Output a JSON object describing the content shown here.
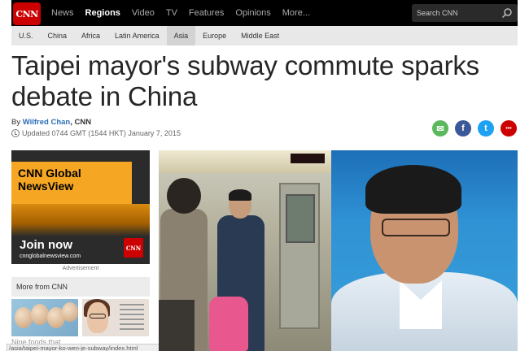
{
  "nav": {
    "logo": "CNN",
    "items": [
      "News",
      "Regions",
      "Video",
      "TV",
      "Features",
      "Opinions",
      "More..."
    ],
    "active": "Regions",
    "search_placeholder": "Search CNN"
  },
  "subnav": {
    "items": [
      "U.S.",
      "China",
      "Africa",
      "Latin America",
      "Asia",
      "Europe",
      "Middle East"
    ],
    "active": "Asia"
  },
  "article": {
    "headline": "Taipei mayor's subway commute sparks debate in China",
    "by_prefix": "By",
    "author": "Wilfred Chan",
    "source": ", CNN",
    "updated": "Updated 0744 GMT (1544 HKT) January 7, 2015"
  },
  "share": [
    {
      "name": "email-share-icon",
      "glyph": "✉",
      "color": "#5cb85c"
    },
    {
      "name": "facebook-share-icon",
      "glyph": "f",
      "color": "#3b5998"
    },
    {
      "name": "twitter-share-icon",
      "glyph": "t",
      "color": "#1da1f2"
    },
    {
      "name": "more-share-icon",
      "glyph": "•••",
      "color": "#cc0000"
    }
  ],
  "ad": {
    "title": "CNN Global NewsView",
    "cta": "Join now",
    "url": "cnnglobalnewsview.com",
    "logo": "CNN",
    "label": "Advertisement"
  },
  "sidebar": {
    "more_title": "More from CNN",
    "caption": "Nine foods that"
  },
  "status_url": "/asia/taipei-mayor-ko-wen-je-subway/index.html",
  "colors": {
    "brand": "#cc0000",
    "nav_bg": "#000000",
    "link": "#2a6db5"
  }
}
